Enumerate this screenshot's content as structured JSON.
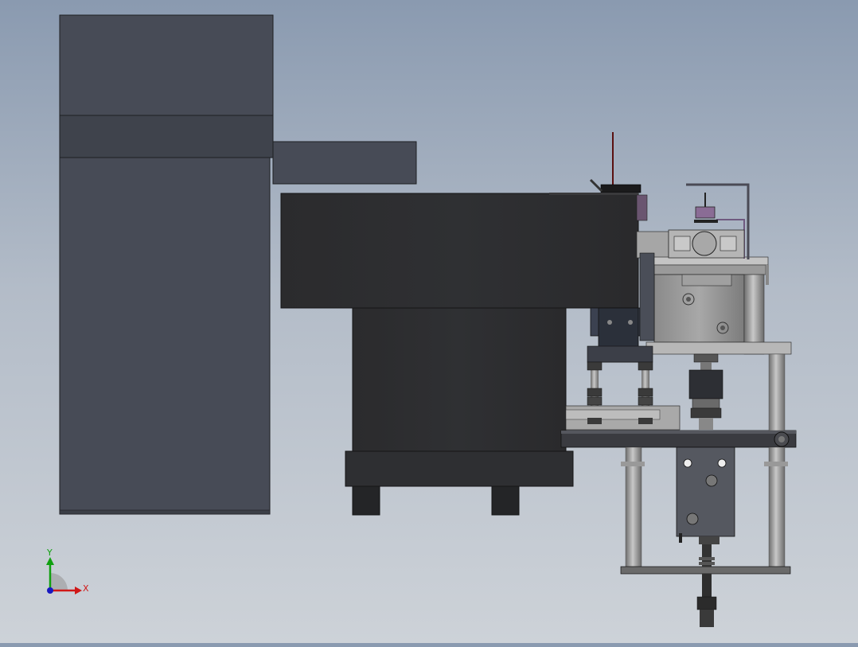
{
  "viewport": {
    "background_top": "#8a9ab0",
    "background_bottom": "#cdd2d8"
  },
  "triad": {
    "x_label": "X",
    "y_label": "Y",
    "x_color": "#d01818",
    "y_color": "#10a010",
    "z_color": "#1818c0"
  },
  "colors": {
    "housing_dark": "#464a55",
    "housing_mid": "#3e424b",
    "hopper_body": "#2c2d30",
    "steel_light": "#b9b9b9",
    "steel_mid": "#8f8f8f",
    "accent_purple": "#7a5a85"
  }
}
